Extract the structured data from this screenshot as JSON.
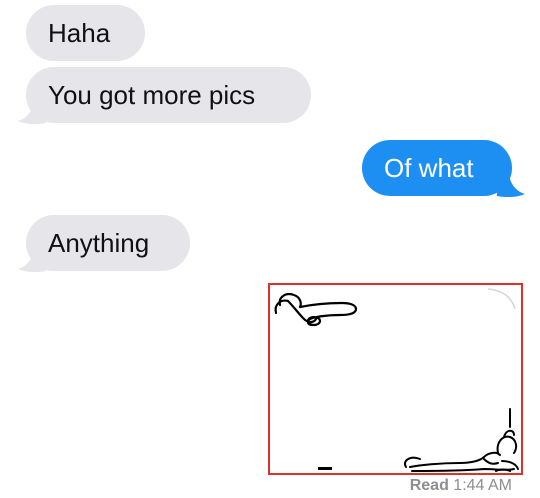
{
  "conversation": {
    "messages": [
      {
        "direction": "incoming",
        "text": "Haha"
      },
      {
        "direction": "incoming",
        "text": "You got more pics"
      },
      {
        "direction": "outgoing",
        "text": "Of what"
      },
      {
        "direction": "incoming",
        "text": "Anything"
      },
      {
        "direction": "outgoing",
        "kind": "image",
        "description": "hand-drawn line doodles"
      }
    ],
    "read_receipt": {
      "label": "Read",
      "time": "1:44 AM"
    }
  },
  "colors": {
    "incoming_bubble": "#e5e5ea",
    "outgoing_bubble": "#1e8ff2",
    "highlight_frame": "#e0302b",
    "receipt_text": "#8e8e93"
  }
}
